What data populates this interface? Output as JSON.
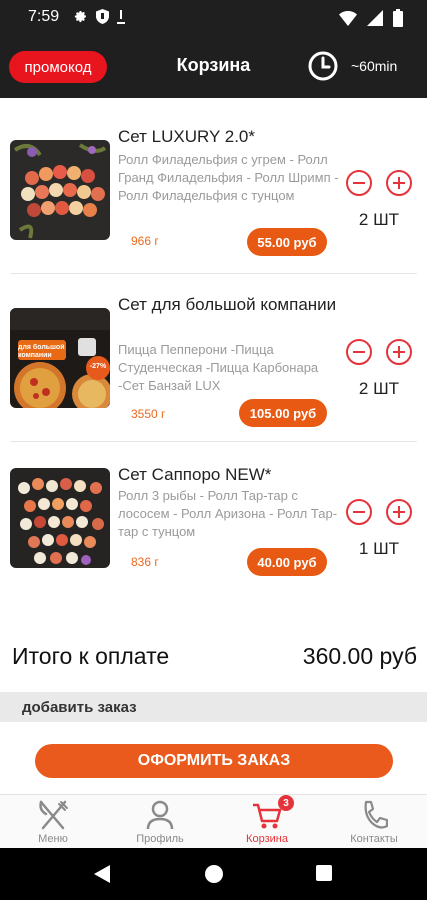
{
  "status_bar": {
    "time": "7:59"
  },
  "header": {
    "promo_label": "промокод",
    "title": "Корзина",
    "delivery_time": "~60min"
  },
  "items": [
    {
      "name": "Сет LUXURY 2.0*",
      "description": "Ролл Филадельфия с угрем - Ролл Гранд Филадельфия - Ролл Шримп - Ролл Филадельфия с тунцом",
      "weight": "966 г",
      "price": "55.00 руб",
      "quantity": "2 ШТ"
    },
    {
      "name": "Сет для большой компании",
      "description": "Пицца Пепперони -Пицца Студенческая -Пицца Карбонара -Сет Банзай LUX",
      "weight": "3550 г",
      "price": "105.00 руб",
      "quantity": "2 ШТ",
      "banner_text": "для большой компании",
      "banner_discount": "-27%"
    },
    {
      "name": "Сет Саппоро NEW*",
      "description": "Ролл 3 рыбы - Ролл Тар-тар с лососем - Ролл Аризона - Ролл Тар-тар с тунцом",
      "weight": "836 г",
      "price": "40.00 руб",
      "quantity": "1 ШТ"
    }
  ],
  "total": {
    "label": "Итого к оплате",
    "value": "360.00 руб"
  },
  "add_order": {
    "label": "добавить заказ"
  },
  "checkout": {
    "label": "ОФОРМИТЬ ЗАКАЗ"
  },
  "bottom_nav": {
    "items": [
      {
        "label": "Меню",
        "icon": "fork-knife-icon"
      },
      {
        "label": "Профиль",
        "icon": "user-icon"
      },
      {
        "label": "Корзина",
        "icon": "cart-icon",
        "active": true
      },
      {
        "label": "Контакты",
        "icon": "phone-icon"
      }
    ],
    "cart_count": "3"
  },
  "colors": {
    "accent": "#e85a14",
    "promo": "#e8141e",
    "qty_button": "#e4333a",
    "header_bg": "#1f1f1f"
  }
}
